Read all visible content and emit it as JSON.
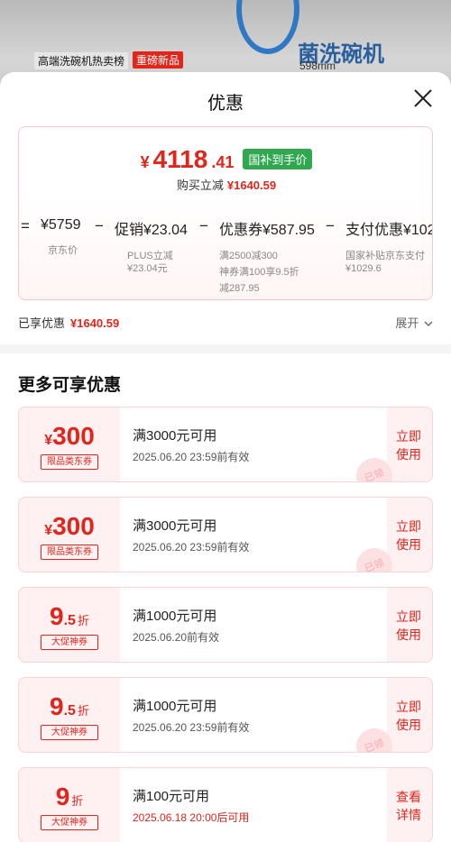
{
  "background": {
    "brand_text": "菌洗碗机",
    "spec_text": "598mm",
    "tag_rank": "高端洗碗机热卖榜",
    "tag_new": "重磅新品"
  },
  "sheet": {
    "title": "优惠"
  },
  "price": {
    "yen": "¥",
    "integer": "4118",
    "decimal": ".41",
    "badge": "国补到手价",
    "reduce_label": "购买立减",
    "reduce_amount": "¥1640.59"
  },
  "formula": {
    "terms": [
      {
        "op": "=",
        "label": "¥5759",
        "sub": [
          "京东价"
        ]
      },
      {
        "op": "−",
        "label": "促销¥23.04",
        "sub": [
          "PLUS立减",
          "¥23.04元"
        ]
      },
      {
        "op": "−",
        "label": "优惠券¥587.95",
        "sub": [
          "满2500减300",
          "神券满100享9.5折",
          "减287.95"
        ]
      },
      {
        "op": "−",
        "label": "支付优惠¥102",
        "sub": [
          "国家补贴京东支付",
          "¥1029.6"
        ]
      }
    ]
  },
  "enjoyed": {
    "label": "已享优惠",
    "amount": "¥1640.59",
    "expand": "展开"
  },
  "more_title": "更多可享优惠",
  "coupons": [
    {
      "sym": "¥",
      "value": "300",
      "unit": "",
      "tag": "限品类东券",
      "condition": "满3000元可用",
      "date": "2025.06.20  23:59前有效",
      "date_red": false,
      "button": [
        "立即",
        "使用"
      ],
      "stamp": "已领"
    },
    {
      "sym": "¥",
      "value": "300",
      "unit": "",
      "tag": "限品类东券",
      "condition": "满3000元可用",
      "date": "2025.06.20  23:59前有效",
      "date_red": false,
      "button": [
        "立即",
        "使用"
      ],
      "stamp": "已领"
    },
    {
      "sym": "",
      "value": "9",
      "small": ".5",
      "unit": "折",
      "tag": "大促神券",
      "condition": "满1000元可用",
      "date": "2025.06.20前有效",
      "date_red": false,
      "button": [
        "立即",
        "使用"
      ],
      "stamp": ""
    },
    {
      "sym": "",
      "value": "9",
      "small": ".5",
      "unit": "折",
      "tag": "大促神券",
      "condition": "满1000元可用",
      "date": "2025.06.20  23:59前有效",
      "date_red": false,
      "button": [
        "立即",
        "使用"
      ],
      "stamp": "已领"
    },
    {
      "sym": "",
      "value": "9",
      "small": "",
      "unit": "折",
      "tag": "大促神券",
      "condition": "满100元可用",
      "date": "2025.06.18  20:00后可用",
      "date_red": true,
      "button": [
        "查看",
        "详情"
      ],
      "stamp": ""
    }
  ],
  "colors": {
    "accent": "#e1251b",
    "badge_green": "#2fa84f",
    "coupon_bg": "#fff0f1"
  }
}
